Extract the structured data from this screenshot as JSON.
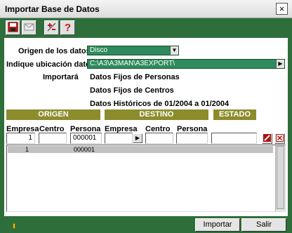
{
  "window": {
    "title": "Importar Base de Datos",
    "close_glyph": "×"
  },
  "toolbar": {
    "buttons": [
      {
        "icon": "save-icon"
      },
      {
        "icon": "mail-icon"
      },
      {
        "icon": "plus-minus-icon"
      },
      {
        "icon": "help-icon",
        "glyph": "?"
      }
    ]
  },
  "form": {
    "origen_label": "Origen de los datos",
    "origen_value": "Disco",
    "ubicacion_label": "Indique ubicación datos",
    "ubicacion_value": "C:\\A3\\A3MAN\\A3EXPORT\\",
    "importara_label": "Importará",
    "importara_items": [
      "Datos Fijos de Personas",
      "Datos Fijos de Centros",
      "Datos Históricos de 01/2004 a 01/2004"
    ]
  },
  "mapping": {
    "headers": {
      "origen": "ORIGEN",
      "destino": "DESTINO",
      "estado": "ESTADO"
    },
    "columns": {
      "empresa_origen": "Empresa",
      "centro_origen": "Centro",
      "persona_origen": "Persona",
      "empresa_destino": "Empresa",
      "centro_destino": "Centro",
      "persona_destino": "Persona"
    },
    "inputs": {
      "empresa_origen": "1",
      "centro_origen": "",
      "persona_origen": "000001",
      "empresa_destino": "",
      "centro_destino": "",
      "persona_destino": "",
      "estado": ""
    },
    "rows": [
      {
        "empresa": "1",
        "persona": "000001"
      }
    ]
  },
  "footer": {
    "importar_label": "Importar",
    "salir_label": "Salir"
  },
  "colors": {
    "frame": "#2e6e3a",
    "section_header": "#8c8c2c",
    "field_highlight": "#2e8b5c",
    "selected_row": "#c0c0c0"
  }
}
